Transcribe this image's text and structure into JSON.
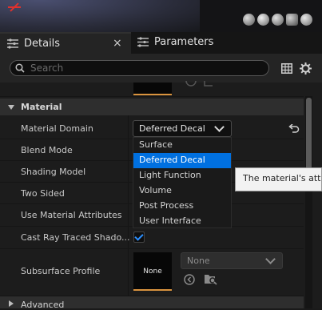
{
  "tabs": {
    "details": {
      "label": "Details",
      "close": "×"
    },
    "parameters": {
      "label": "Parameters"
    }
  },
  "search": {
    "placeholder": "Search",
    "value": ""
  },
  "section": {
    "title": "Material"
  },
  "properties": {
    "material_domain": {
      "label": "Material Domain",
      "value": "Deferred Decal"
    },
    "blend_mode": {
      "label": "Blend Mode"
    },
    "shading_model": {
      "label": "Shading Model"
    },
    "two_sided": {
      "label": "Two Sided"
    },
    "use_material_attributes": {
      "label": "Use Material Attributes"
    },
    "cast_ray_traced_shadows": {
      "label": "Cast Ray Traced Shado...",
      "checked": true
    },
    "subsurface_profile": {
      "label": "Subsurface Profile",
      "thumbnail_text": "None",
      "combo_value": "None"
    }
  },
  "dropdown": {
    "options": [
      "Surface",
      "Deferred Decal",
      "Light Function",
      "Volume",
      "Post Process",
      "User Interface"
    ],
    "selected": "Deferred Decal"
  },
  "tooltip": {
    "text": "The material's attribute domain"
  },
  "next_section": {
    "title": "Advanced"
  },
  "colors": {
    "accent": "#0070e0",
    "check": "#2c8fff",
    "thumb_border": "#d9933e",
    "axis": "#e0312d"
  },
  "icons": [
    "search-icon",
    "grid-view-icon",
    "settings-gear-icon",
    "reset-arrow-icon",
    "browse-icon",
    "use-selected-icon",
    "details-tab-icon",
    "parameters-tab-icon"
  ]
}
